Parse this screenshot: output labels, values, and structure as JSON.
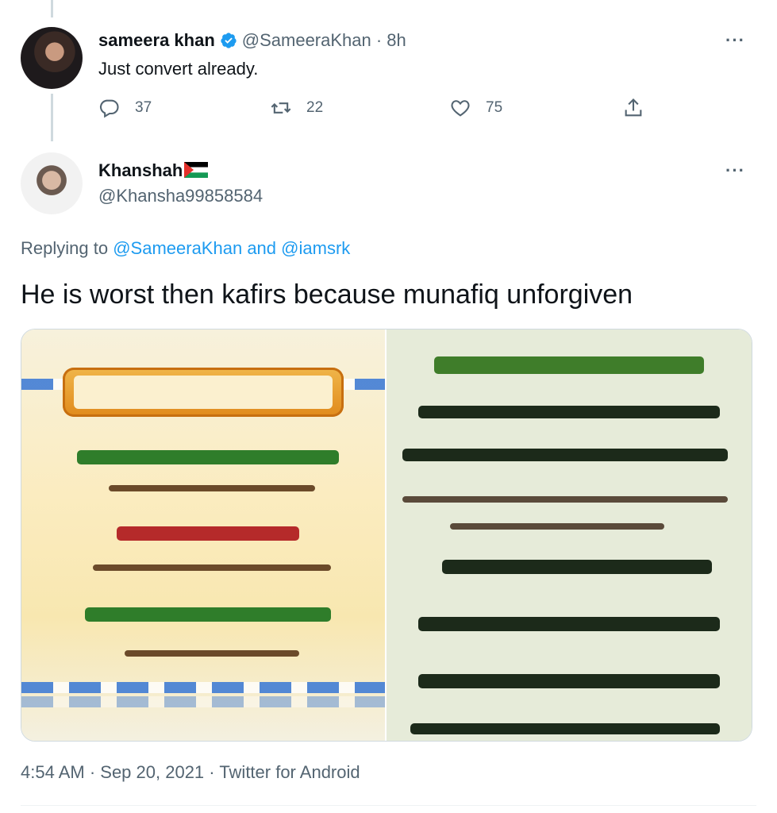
{
  "parent_tweet": {
    "author_name": "sameera khan",
    "handle_time": "@SameeraKhan · 8h",
    "text": "Just convert already.",
    "replies": "37",
    "retweets": "22",
    "likes": "75"
  },
  "reply_tweet": {
    "author_name": "Khanshah",
    "handle": "@Khansha99858584",
    "replying_prefix": "Replying to",
    "replying_user1": "@SameeraKhan",
    "replying_and": "and",
    "replying_user2": "@iamsrk",
    "text": "He is worst then kafirs because munafiq unforgiven",
    "footer": "4:54 AM · Sep 20, 2021 · Twitter for Android"
  },
  "icons": {
    "verified": "verified-badge-icon",
    "more": "more-icon",
    "reply": "reply-icon",
    "retweet": "retweet-icon",
    "like": "heart-icon",
    "share": "share-icon",
    "flag": "palestine-flag-icon"
  },
  "colors": {
    "link": "#1d9bf0",
    "secondary_text": "#536471",
    "primary_text": "#0f1419"
  }
}
